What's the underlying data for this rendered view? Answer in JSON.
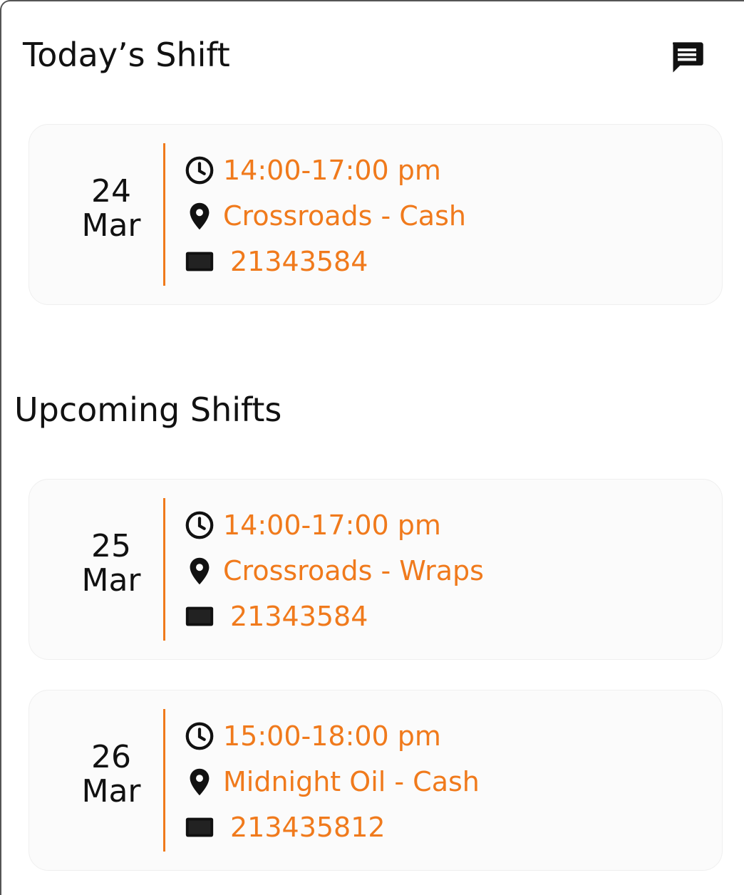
{
  "today": {
    "heading": "Today’s Shift",
    "chat_icon": "chat-icon",
    "shifts": [
      {
        "day": "24",
        "month": "Mar",
        "time": "14:00-17:00 pm",
        "location": "Crossroads - Cash",
        "id": "21343584"
      }
    ]
  },
  "upcoming": {
    "heading": "Upcoming Shifts",
    "shifts": [
      {
        "day": "25",
        "month": "Mar",
        "time": "14:00-17:00 pm",
        "location": "Crossroads - Wraps",
        "id": "21343584"
      },
      {
        "day": "26",
        "month": "Mar",
        "time": "15:00-18:00 pm",
        "location": "Midnight Oil - Cash",
        "id": "213435812"
      }
    ]
  },
  "icons": {
    "time": "clock-icon",
    "location": "location-pin-icon",
    "id": "id-card-icon"
  },
  "colors": {
    "accent": "#f07a1c",
    "text": "#111111",
    "card_bg": "#fbfbfb"
  }
}
